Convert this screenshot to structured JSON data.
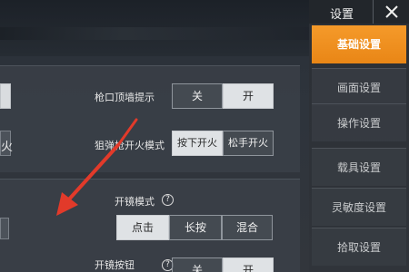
{
  "sidebar": {
    "title": "设置",
    "close_icon": "close-icon",
    "items": [
      {
        "label": "基础设置",
        "active": true
      },
      {
        "label": "画面设置",
        "active": false
      },
      {
        "label": "操作设置",
        "active": false
      },
      {
        "label": "载具设置",
        "active": false
      },
      {
        "label": "灵敏度设置",
        "active": false
      },
      {
        "label": "拾取设置",
        "active": false
      }
    ]
  },
  "settings": {
    "partial_left_char": "火",
    "row1": {
      "label": "枪口顶墙提示",
      "off": "关",
      "on": "开",
      "selected": "开"
    },
    "row2": {
      "label": "狙弹枪开火模式",
      "opt_a": "按下开火",
      "opt_b": "松手开火",
      "selected": "按下开火"
    },
    "row3": {
      "label": "开镜模式",
      "help": "?",
      "opt_a": "点击",
      "opt_b": "长按",
      "opt_c": "混合",
      "selected": "点击"
    },
    "row4": {
      "label": "开镜按钮",
      "help": "?",
      "off": "关",
      "on": "开",
      "selected": "开"
    }
  },
  "colors": {
    "accent": "#f08f1f",
    "arrow": "#e23a2a",
    "selected_segment": "#dfe2e5"
  }
}
